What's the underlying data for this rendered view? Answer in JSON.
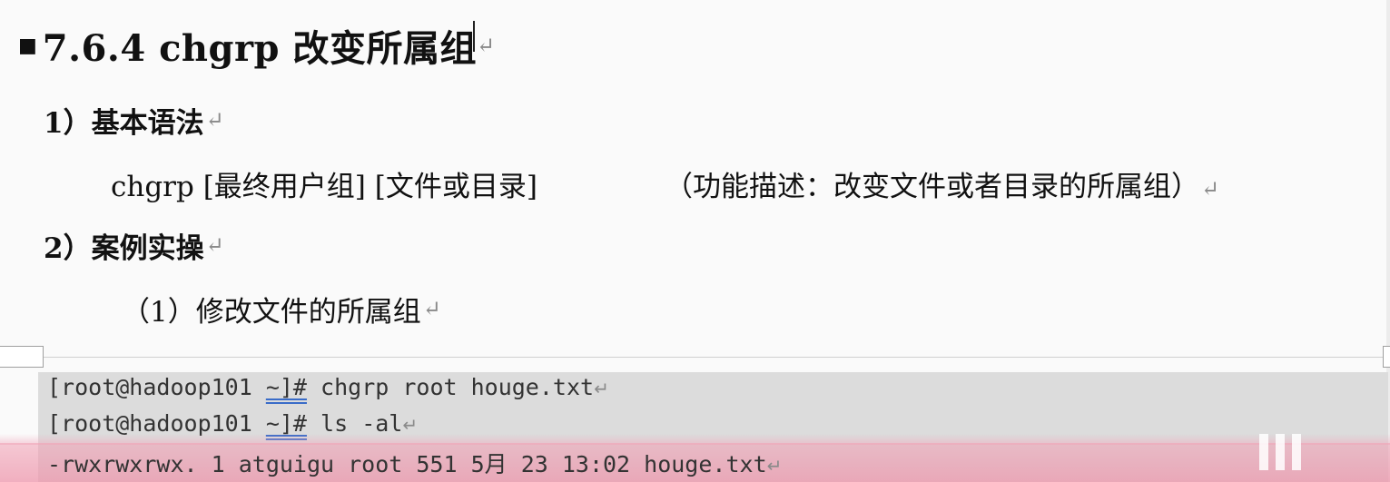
{
  "heading": {
    "text": "7.6.4 chgrp 改变所属组",
    "para_mark": "↵"
  },
  "section1": {
    "title": "1）基本语法",
    "para_mark": "↵"
  },
  "syntax": {
    "command": "chgrp [最终用户组] [文件或目录]",
    "description": "（功能描述：改变文件或者目录的所属组）",
    "para_mark": "↵"
  },
  "section2": {
    "title": "2）案例实操",
    "para_mark": "↵"
  },
  "example1": {
    "title": "（1）修改文件的所属组",
    "para_mark": "↵"
  },
  "code": {
    "line1": {
      "prefix": "[root@hadoop101 ",
      "path": "~]#",
      "command": " chgrp root houge.txt",
      "para_mark": "↵"
    },
    "line2": {
      "prefix": "[root@hadoop101 ",
      "path": "~]#",
      "command": " ls -al",
      "para_mark": "↵"
    },
    "line3": {
      "text": "-rwxrwxrwx. 1 atguigu root 551 5月  23 13:02 houge.txt",
      "para_mark": "↵"
    }
  }
}
